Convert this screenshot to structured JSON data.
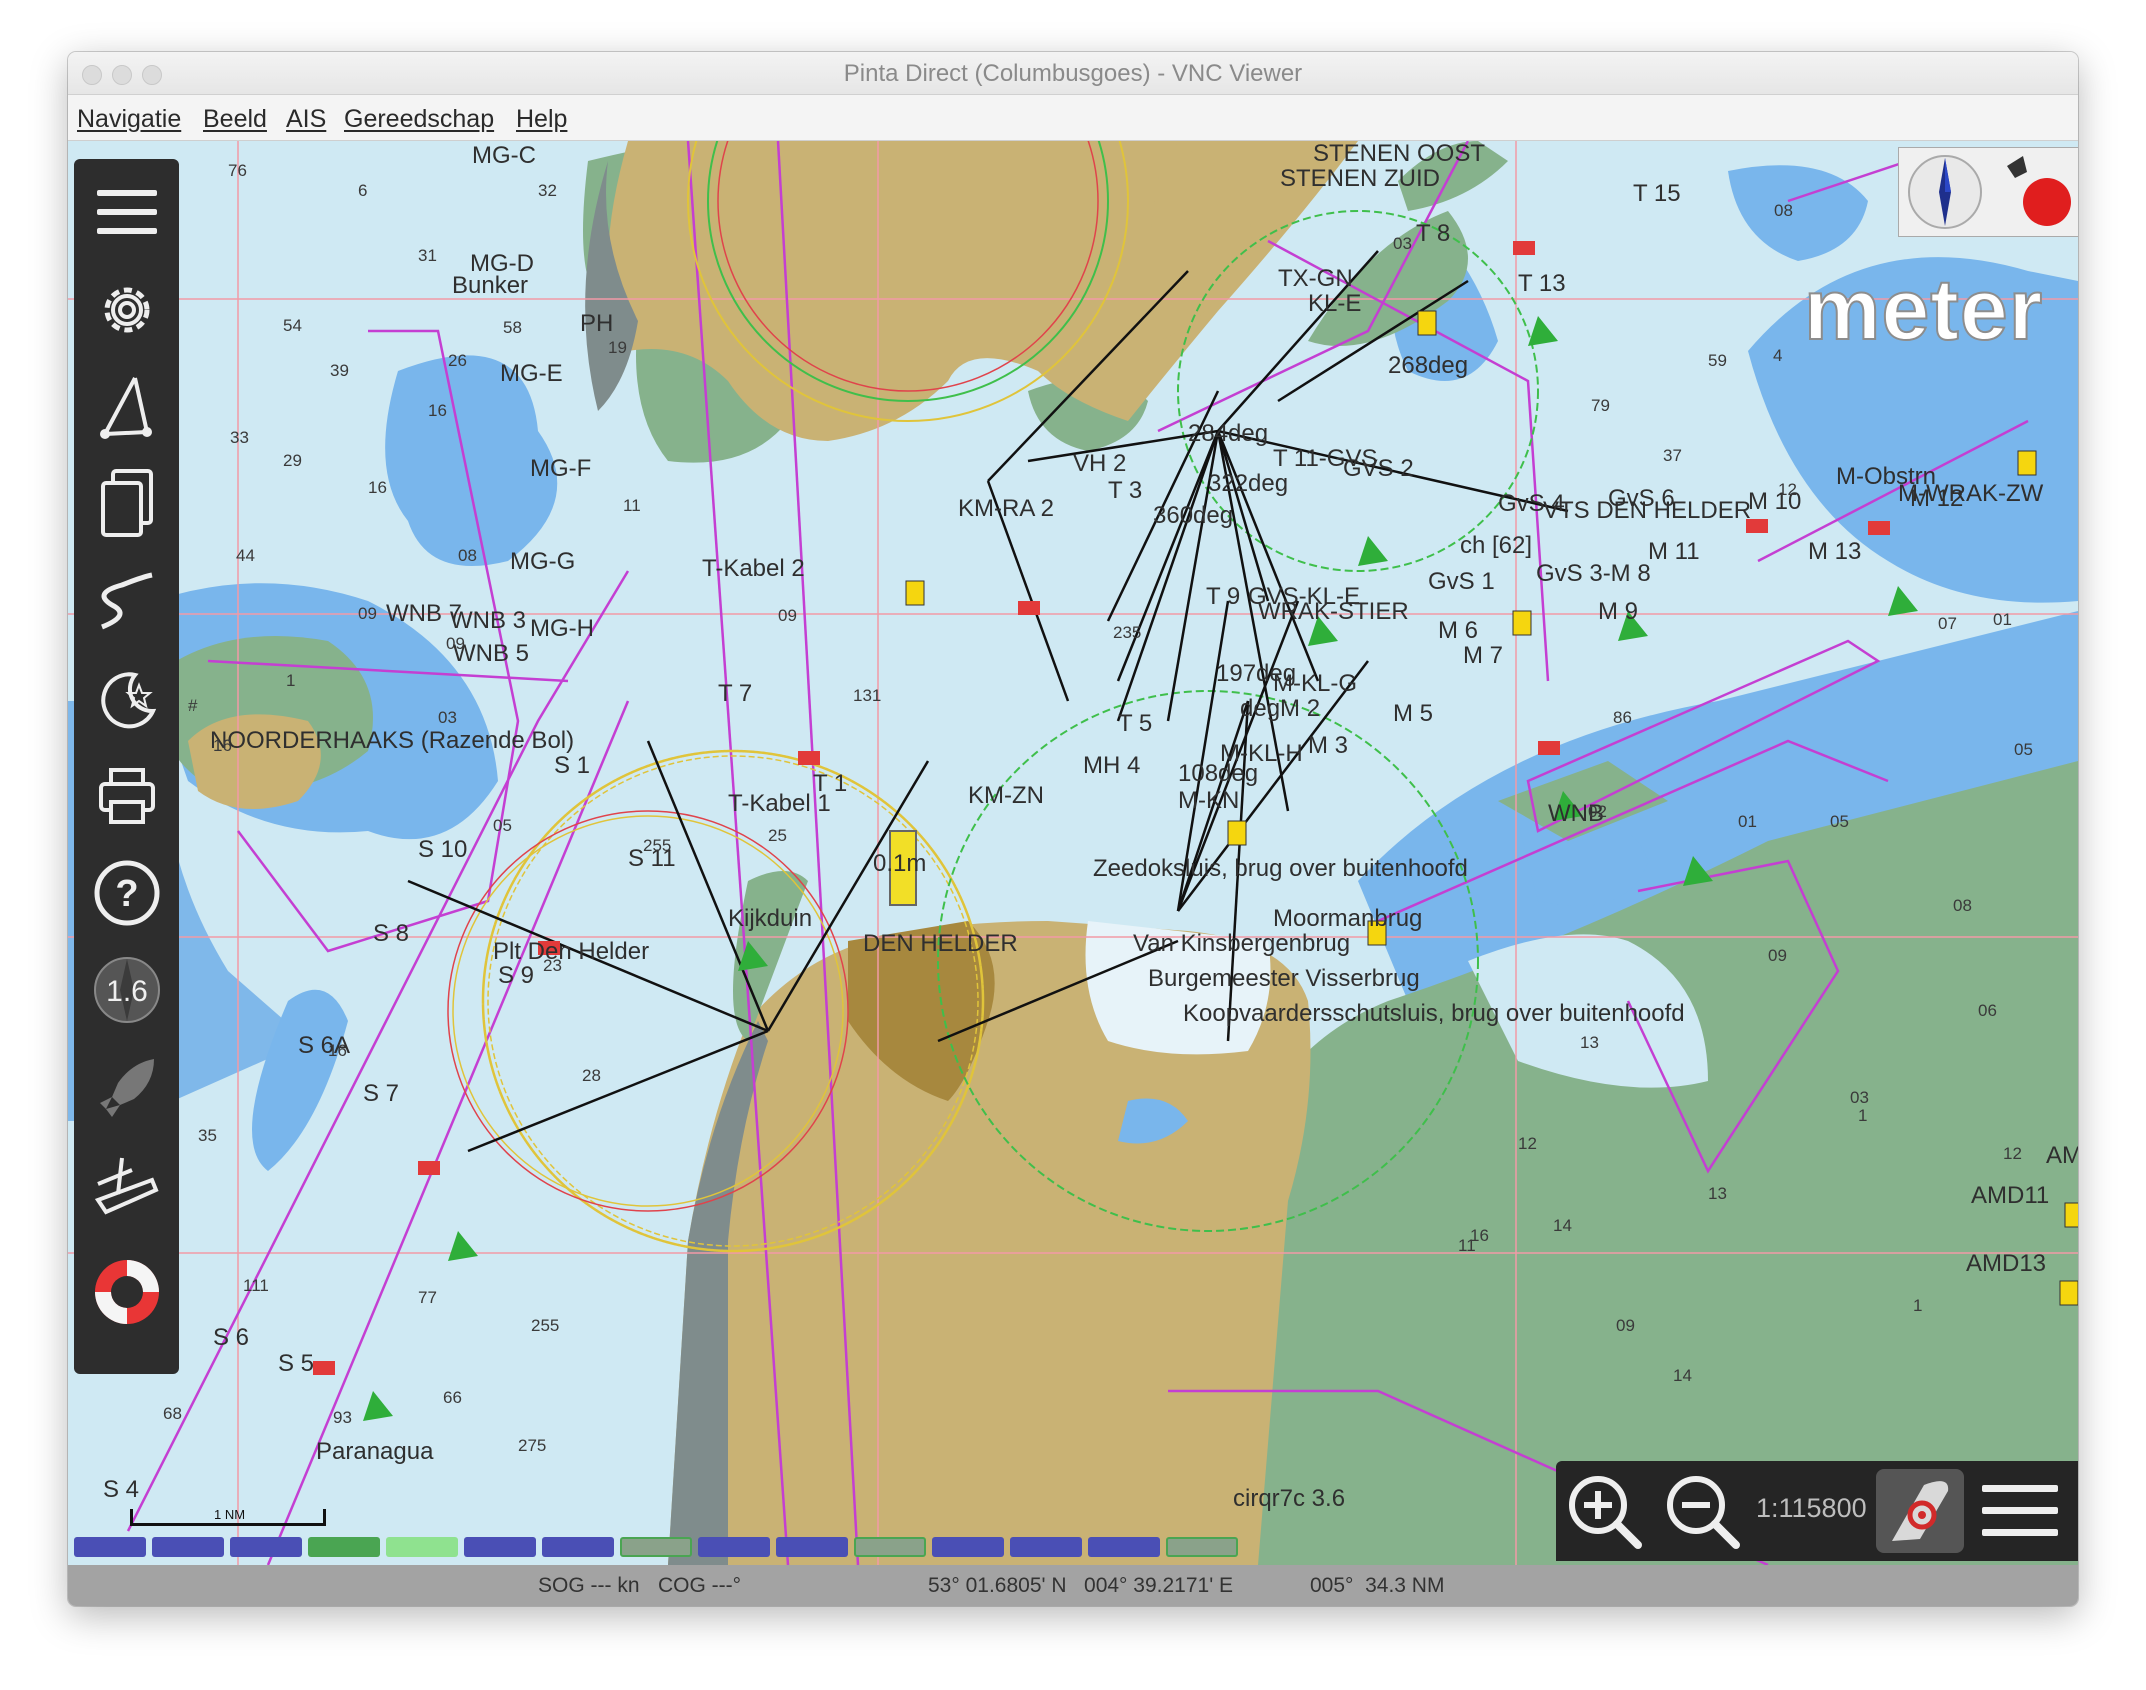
{
  "window": {
    "title": "Pinta Direct (Columbusgoes) - VNC Viewer"
  },
  "menu": [
    "Navigatie",
    "Beeld",
    "AIS",
    "Gereedschap",
    "Help"
  ],
  "toolbar": {
    "tools": [
      {
        "name": "hamburger-menu-icon"
      },
      {
        "name": "settings-gear-icon"
      },
      {
        "name": "route-compass-icon"
      },
      {
        "name": "documents-icon"
      },
      {
        "name": "track-icon"
      },
      {
        "name": "night-mode-icon"
      },
      {
        "name": "print-icon"
      },
      {
        "name": "help-icon"
      },
      {
        "name": "speed-compass-icon"
      },
      {
        "name": "rocket-icon"
      },
      {
        "name": "boat-icon"
      },
      {
        "name": "lifebuoy-icon"
      }
    ],
    "speed_value": "1.6"
  },
  "overlay": {
    "units_label": "meter"
  },
  "chart": {
    "place_labels": [
      "STENEN OOST",
      "STENEN ZUID",
      "T 15",
      "MG-C",
      "MG-D",
      "Bunker",
      "PH",
      "MG-E",
      "TX-GN",
      "KL-E",
      "T 13",
      "268deg",
      "T 8",
      "MG-F",
      "KM-RA 2",
      "VH 2",
      "T 3",
      "284deg",
      "322deg",
      "T 11-GVS",
      "GVS 2",
      "GvS 4",
      "GvS 6",
      "VTS DEN HELDER",
      "M 10",
      "M-Obstrn",
      "M-WRAK-ZW",
      "M 12",
      "360deg",
      "ch [62]",
      "MG-G",
      "T-Kabel 2",
      "T 9",
      "GvS 1",
      "GVS-KL-E",
      "GvS 3-M 8",
      "M 11",
      "M 13",
      "WRAK-STIER",
      "M 9",
      "M 6",
      "WNB 7",
      "WNB 3",
      "MG-H",
      "WNB 5",
      "M 7",
      "197deg",
      "M-KL-G",
      "NOORDERHAAKS (Razende Bol)",
      "T 7",
      "T 5",
      "degM 2",
      "M 5",
      "M-KL-H",
      "M 3",
      "S 1",
      "T 1",
      "T-Kabel 1",
      "KM-ZN",
      "MH 4",
      "108deg",
      "M-KN",
      "WNB",
      "0.1m",
      "S 10",
      "S 11",
      "Kijkduin",
      "DEN HELDER",
      "Zeedoksluis, brug over buitenhoofd",
      "Van Kinsbergenbrug",
      "Moormanbrug",
      "S 8",
      "Plt Den Helder",
      "S 9",
      "Burgemeester Visserbrug",
      "Koopvaardersschutsluis, brug over buitenhoofd",
      "S 6A",
      "S 7",
      "AMD11",
      "AMD13",
      "S 6",
      "S 5",
      "Paranagua",
      "S 4",
      "cirqr7c 3.6",
      "AM"
    ],
    "depths": [
      "76",
      "6",
      "32",
      "31",
      "54",
      "58",
      "39",
      "16",
      "33",
      "29",
      "44",
      "08",
      "16",
      "09",
      "03",
      "09",
      "1",
      "16",
      "#",
      "05",
      "26",
      "19",
      "11",
      "09",
      "131",
      "255",
      "25",
      "23",
      "16",
      "28",
      "35",
      "68",
      "66",
      "275",
      "77",
      "111",
      "93",
      "255",
      "235",
      "03",
      "79",
      "37",
      "59",
      "4",
      "08",
      "03",
      "12",
      "05",
      "07",
      "01",
      "02",
      "05",
      "01",
      "08",
      "09",
      "06",
      "1",
      "12",
      "13",
      "13",
      "03",
      "1",
      "16",
      "14",
      "09",
      "14",
      "15",
      "12",
      "11",
      "86"
    ],
    "scalebar_label": "1 NM",
    "scale": "1:115800",
    "strip_colors": [
      "#4a4fb5",
      "#4a4fb5",
      "#4a4fb5",
      "#4aa552",
      "#8fe28f",
      "#4a4fb5",
      "#4a4fb5",
      "#8aa28a",
      "#4a4fb5",
      "#4a4fb5",
      "#8aa28a",
      "#4a4fb5",
      "#4a4fb5",
      "#4a4fb5",
      "#8aa28a"
    ]
  },
  "zoom": {
    "zoom_in": "zoom-in-icon",
    "zoom_out": "zoom-out-icon",
    "scale": "1:115800",
    "boat_mode": "boat-position-icon",
    "list_menu": "list-menu-icon"
  },
  "status": {
    "sog": "SOG --- kn",
    "cog": "COG ---°",
    "position": "53° 01.6805' N   004° 39.2171' E",
    "bearing": "005°  34.3 NM"
  }
}
